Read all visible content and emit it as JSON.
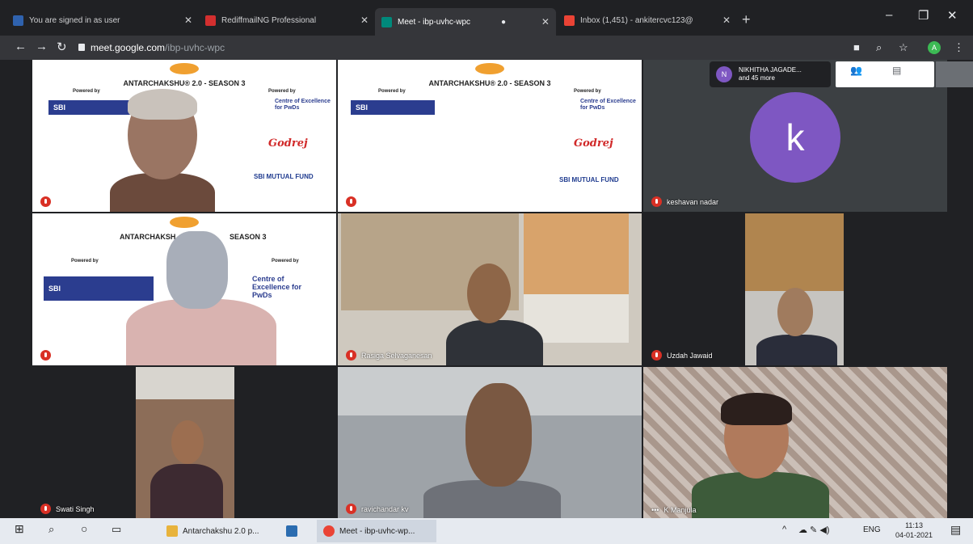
{
  "browser": {
    "tabs": [
      {
        "label": "You are signed in as user",
        "color": "#2f62ae"
      },
      {
        "label": "RediffmailNG Professional",
        "color": "#d32f2f"
      },
      {
        "label": "Meet - ibp-uvhc-wpc",
        "color": "#00897b"
      },
      {
        "label": "Inbox (1,451) - ankitercvc123@",
        "color": "#ea4335"
      }
    ],
    "url_host": "meet.google.com",
    "url_path": "/ibp-uvhc-wpc",
    "profile_initial": "A"
  },
  "slide": {
    "title_full": "ANTARCHAKSHU® 2.0 - SEASON 3",
    "title_left": "ANTARCHAKSH",
    "title_right": "SEASON 3",
    "powered_by": "Powered by",
    "sbi": "SBI",
    "sbi_sub": "FOUNDATION",
    "coe": "Centre of Excellence for PwDs",
    "godrej": "Godrej",
    "smf": "SBI MUTUAL FUND",
    "smf_sub": "A PARTNER FOR LIFE"
  },
  "pinned": {
    "initial": "N",
    "name": "NIKHITHA JAGADE...",
    "more": "and 45 more"
  },
  "participants": {
    "t1": "",
    "t2": "",
    "t3": "keshavan nadar",
    "t3_initial": "k",
    "t4": "",
    "t5": "Rasiga Selvaganesan",
    "t6": "Uzdah Jawaid",
    "t7": "Swati Singh",
    "t8": "ravichandar kv",
    "t9": "K Manjula"
  },
  "taskbar": {
    "folder_label": "Antarchakshu 2.0 p...",
    "chrome_label": "Meet - ibp-uvhc-wp...",
    "lang": "ENG",
    "time": "11:13",
    "date": "04-01-2021"
  }
}
